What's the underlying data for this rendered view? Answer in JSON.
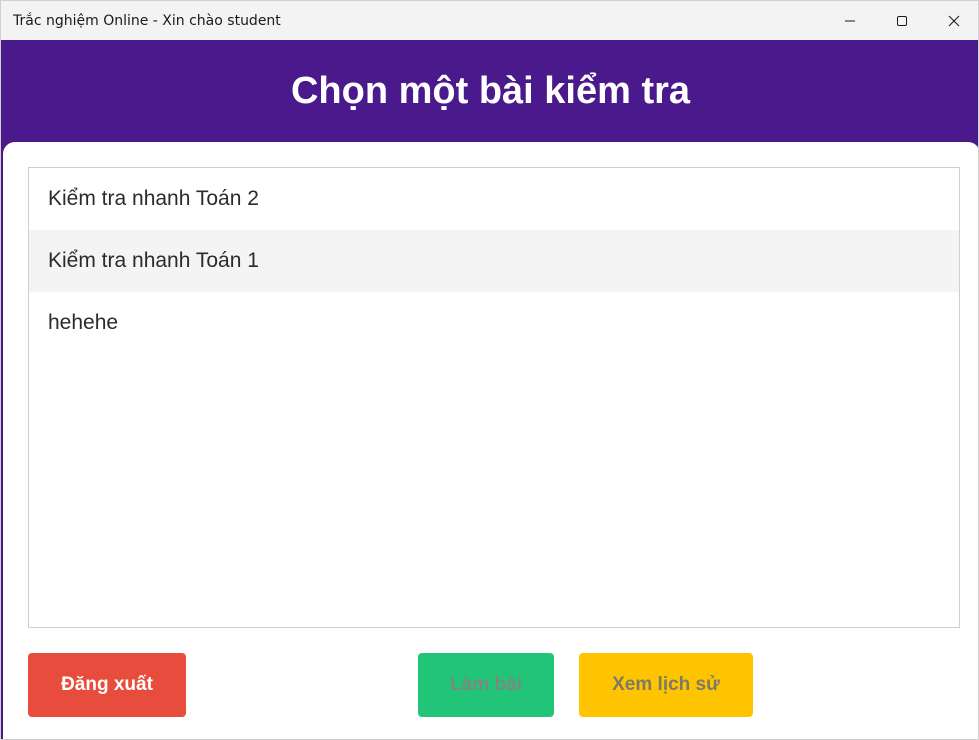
{
  "window": {
    "title": "Trắc nghiệm Online - Xin chào student"
  },
  "header": {
    "title": "Chọn một bài kiểm tra"
  },
  "quiz_list": {
    "items": [
      {
        "label": "Kiểm tra nhanh Toán 2"
      },
      {
        "label": "Kiểm tra nhanh Toán 1"
      },
      {
        "label": "hehehe"
      }
    ]
  },
  "actions": {
    "logout_label": "Đăng xuất",
    "take_quiz_label": "Làm bài",
    "history_label": "Xem lịch sử"
  },
  "colors": {
    "header_bg": "#4a1a8c",
    "logout": "#e74c3c",
    "take_quiz": "#22c477",
    "history": "#ffc400"
  },
  "icons": {
    "minimize": "minimize-icon",
    "maximize": "maximize-icon",
    "close": "close-icon"
  }
}
